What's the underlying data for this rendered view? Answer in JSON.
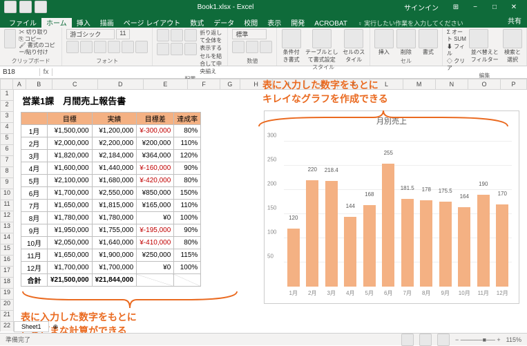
{
  "app": {
    "filename": "Book1.xlsx",
    "appname": "Excel",
    "signin": "サインイン",
    "share": "共有"
  },
  "tabs": [
    "ファイル",
    "ホーム",
    "挿入",
    "描画",
    "ページ レイアウト",
    "数式",
    "データ",
    "校閲",
    "表示",
    "開発",
    "ACROBAT"
  ],
  "tellme": "実行したい作業を入力してください",
  "ribbon_groups": [
    "クリップボード",
    "フォント",
    "配置",
    "数値",
    "スタイル",
    "セル",
    "編集"
  ],
  "ribbon_items": {
    "cut": "切り取り",
    "copy": "コピー",
    "paste": "貼り付け",
    "format_painter": "書式のコピー/貼り付け",
    "font": "游ゴシック",
    "wrap": "折り返して全体を表示する",
    "merge": "セルを結合して中央揃え",
    "numfmt": "標準",
    "cond": "条件付き書式",
    "table": "テーブルとして書式設定",
    "cellstyle": "セルのスタイル",
    "insert": "挿入",
    "delete": "削除",
    "format": "書式",
    "autosum": "オート SUM",
    "fill": "フィル",
    "clear": "クリア",
    "sort": "並べ替えとフィルター",
    "find": "検索と選択"
  },
  "namebox": "B18",
  "report": {
    "title": "営業1課　月間売上報告書",
    "headers": [
      "",
      "目標",
      "実績",
      "目標差",
      "達成率"
    ],
    "rows": [
      {
        "m": "1月",
        "t": "¥1,500,000",
        "a": "¥1,200,000",
        "d": "¥-300,000",
        "r": "80%",
        "neg": true
      },
      {
        "m": "2月",
        "t": "¥2,000,000",
        "a": "¥2,200,000",
        "d": "¥200,000",
        "r": "110%"
      },
      {
        "m": "3月",
        "t": "¥1,820,000",
        "a": "¥2,184,000",
        "d": "¥364,000",
        "r": "120%"
      },
      {
        "m": "4月",
        "t": "¥1,600,000",
        "a": "¥1,440,000",
        "d": "¥-160,000",
        "r": "90%",
        "neg": true
      },
      {
        "m": "5月",
        "t": "¥2,100,000",
        "a": "¥1,680,000",
        "d": "¥-420,000",
        "r": "80%",
        "neg": true
      },
      {
        "m": "6月",
        "t": "¥1,700,000",
        "a": "¥2,550,000",
        "d": "¥850,000",
        "r": "150%"
      },
      {
        "m": "7月",
        "t": "¥1,650,000",
        "a": "¥1,815,000",
        "d": "¥165,000",
        "r": "110%"
      },
      {
        "m": "8月",
        "t": "¥1,780,000",
        "a": "¥1,780,000",
        "d": "¥0",
        "r": "100%"
      },
      {
        "m": "9月",
        "t": "¥1,950,000",
        "a": "¥1,755,000",
        "d": "¥-195,000",
        "r": "90%",
        "neg": true
      },
      {
        "m": "10月",
        "t": "¥2,050,000",
        "a": "¥1,640,000",
        "d": "¥-410,000",
        "r": "80%",
        "neg": true
      },
      {
        "m": "11月",
        "t": "¥1,650,000",
        "a": "¥1,900,000",
        "d": "¥250,000",
        "r": "115%"
      },
      {
        "m": "12月",
        "t": "¥1,700,000",
        "a": "¥1,700,000",
        "d": "¥0",
        "r": "100%"
      }
    ],
    "total": {
      "label": "合計",
      "t": "¥21,500,000",
      "a": "¥21,844,000"
    }
  },
  "chart_data": {
    "type": "bar",
    "title": "月別売上",
    "categories": [
      "1月",
      "2月",
      "3月",
      "4月",
      "5月",
      "6月",
      "7月",
      "8月",
      "9月",
      "10月",
      "11月",
      "12月"
    ],
    "values": [
      120,
      220,
      218.4,
      144,
      168,
      255,
      181.5,
      178,
      175.5,
      164,
      190,
      170
    ],
    "ylim": [
      0,
      300
    ],
    "yticks": [
      50,
      100,
      150,
      200,
      250,
      300
    ],
    "ylabel": "",
    "xlabel": ""
  },
  "annotations": {
    "top": "表に入力した数字をもとに\nキレイなグラフを作成できる",
    "bottom": "表に入力した数字をもとに\nさまざまな計算ができる"
  },
  "status": {
    "left": "準備完了",
    "sheet": "Sheet1",
    "zoom": "115%"
  },
  "cols": [
    "A",
    "B",
    "C",
    "D",
    "E",
    "F",
    "G",
    "H",
    "I",
    "J",
    "K",
    "L",
    "M",
    "N",
    "O",
    "P"
  ],
  "rownums": [
    1,
    2,
    3,
    4,
    5,
    6,
    7,
    8,
    9,
    10,
    11,
    12,
    13,
    14,
    15,
    16,
    17,
    18,
    19,
    20,
    21,
    22
  ]
}
